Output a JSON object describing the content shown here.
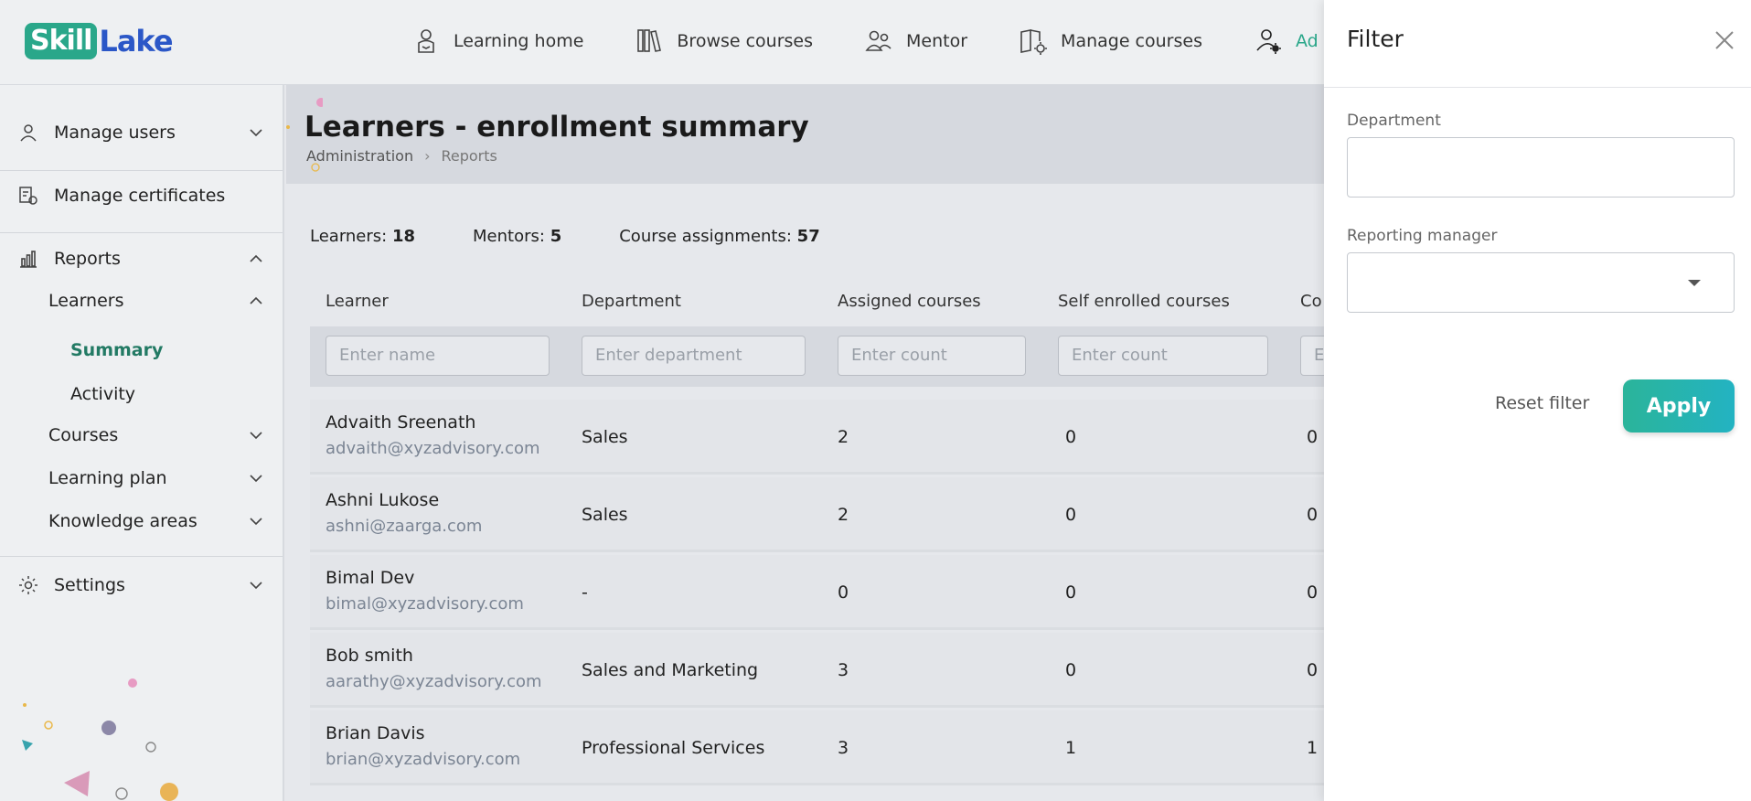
{
  "logo": {
    "part1": "Skill",
    "part2": "Lake"
  },
  "nav": [
    {
      "label": "Learning home",
      "icon": "learner-icon"
    },
    {
      "label": "Browse courses",
      "icon": "books-icon"
    },
    {
      "label": "Mentor",
      "icon": "mentor-icon"
    },
    {
      "label": "Manage courses",
      "icon": "manage-courses-icon"
    },
    {
      "label": "Ad",
      "icon": "admin-icon"
    }
  ],
  "sidebar": {
    "manage_users": "Manage users",
    "manage_certificates": "Manage certificates",
    "reports": "Reports",
    "learners": "Learners",
    "summary": "Summary",
    "activity": "Activity",
    "courses": "Courses",
    "learning_plan": "Learning plan",
    "knowledge_areas": "Knowledge areas",
    "settings": "Settings"
  },
  "page": {
    "title": "Learners - enrollment summary",
    "breadcrumb": [
      "Administration",
      "Reports"
    ]
  },
  "stats": {
    "learners_label": "Learners:",
    "learners_value": "18",
    "mentors_label": "Mentors:",
    "mentors_value": "5",
    "assignments_label": "Course assignments:",
    "assignments_value": "57"
  },
  "table": {
    "headers": [
      "Learner",
      "Department",
      "Assigned courses",
      "Self enrolled courses",
      "Co"
    ],
    "placeholders": [
      "Enter name",
      "Enter department",
      "Enter count",
      "Enter count",
      "E"
    ],
    "rows": [
      {
        "name": "Advaith Sreenath",
        "email": "advaith@xyzadvisory.com",
        "department": "Sales",
        "assigned": "2",
        "self": "0",
        "completed": "0"
      },
      {
        "name": "Ashni Lukose",
        "email": "ashni@zaarga.com",
        "department": "Sales",
        "assigned": "2",
        "self": "0",
        "completed": "0"
      },
      {
        "name": "Bimal Dev",
        "email": "bimal@xyzadvisory.com",
        "department": "-",
        "assigned": "0",
        "self": "0",
        "completed": "0"
      },
      {
        "name": "Bob smith",
        "email": "aarathy@xyzadvisory.com",
        "department": "Sales and Marketing",
        "assigned": "3",
        "self": "0",
        "completed": "0"
      },
      {
        "name": "Brian Davis",
        "email": "brian@xyzadvisory.com",
        "department": "Professional Services",
        "assigned": "3",
        "self": "1",
        "completed": "1"
      }
    ]
  },
  "filter": {
    "title": "Filter",
    "department_label": "Department",
    "department_value": "",
    "manager_label": "Reporting manager",
    "manager_value": "",
    "reset_label": "Reset filter",
    "apply_label": "Apply"
  },
  "colors": {
    "accent": "#2aa78a",
    "logo_blue": "#2b57c7",
    "apply_start": "#2bb49a",
    "apply_end": "#23b3c2"
  }
}
